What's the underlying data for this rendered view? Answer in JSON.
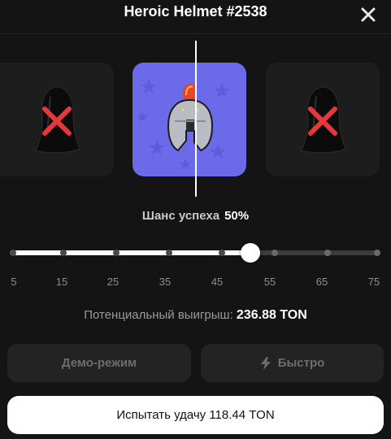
{
  "header": {
    "title": "Heroic Helmet #2538"
  },
  "items": {
    "left": {
      "icon": "hooded-cloak-icon",
      "status": "x-mark-icon"
    },
    "center": {
      "icon": "spartan-helmet-icon"
    },
    "right": {
      "icon": "hooded-cloak-icon",
      "status": "x-mark-icon"
    }
  },
  "chance": {
    "label": "Шанс успеха",
    "value": "50%"
  },
  "slider": {
    "ticks": [
      "5",
      "15",
      "25",
      "35",
      "45",
      "55",
      "65",
      "75"
    ],
    "selected_percent": 50
  },
  "payout": {
    "label": "Потенциальный выигрыш:",
    "value": "236.88 TON"
  },
  "buttons": {
    "demo_label": "Демо-режим",
    "fast_label": "Быстро",
    "try_label": "Испытать удачу 118.44 TON"
  },
  "colors": {
    "accent": "#6b6ae8",
    "fail": "#e5383b",
    "background": "#141414"
  }
}
